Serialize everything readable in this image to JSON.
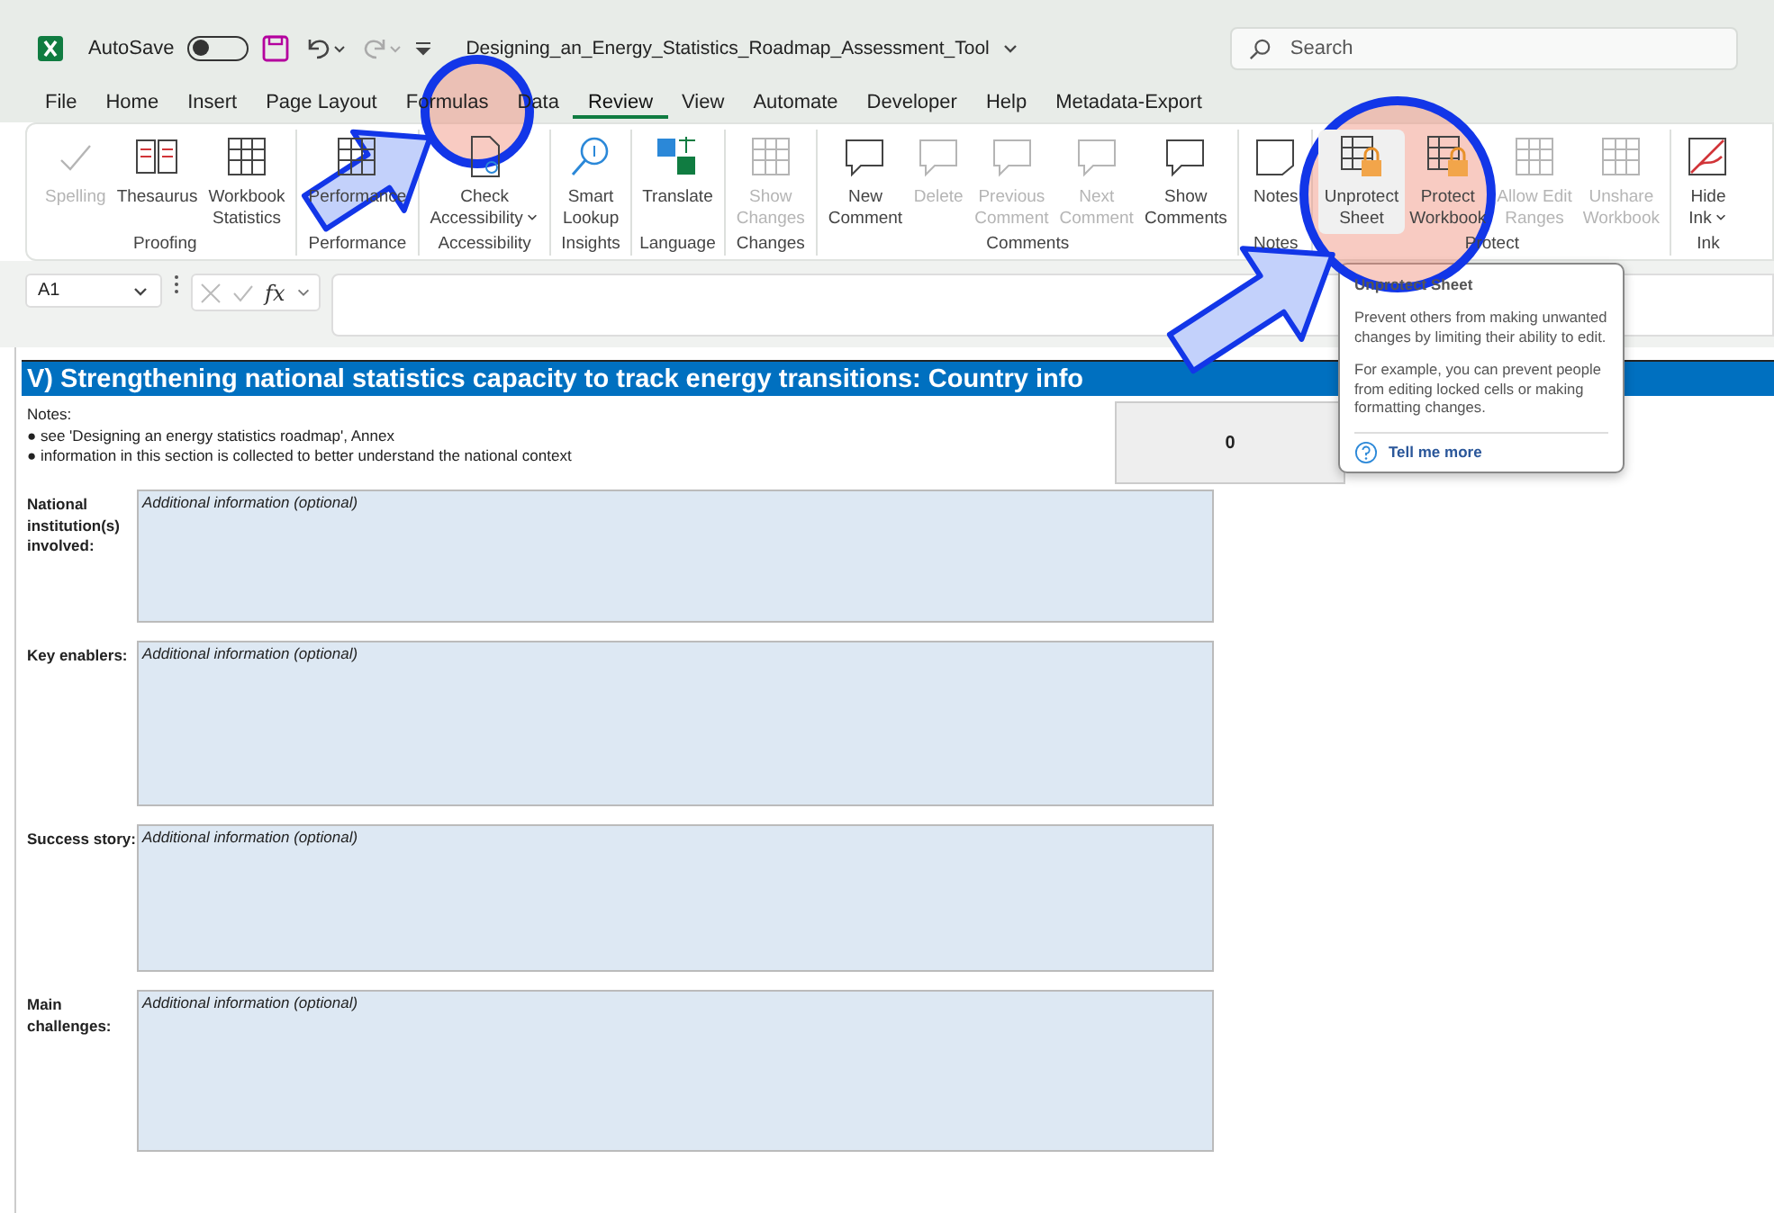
{
  "title_bar": {
    "autosave": {
      "label": "AutoSave",
      "on": false
    },
    "file_name": "Designing_an_Energy_Statistics_Roadmap_Assessment_Tool",
    "search": {
      "placeholder": "Search"
    }
  },
  "tabs": [
    {
      "label": "File",
      "selected": false
    },
    {
      "label": "Home",
      "selected": false
    },
    {
      "label": "Insert",
      "selected": false
    },
    {
      "label": "Page Layout",
      "selected": false
    },
    {
      "label": "Formulas",
      "selected": false
    },
    {
      "label": "Data",
      "selected": false
    },
    {
      "label": "Review",
      "selected": true
    },
    {
      "label": "View",
      "selected": false
    },
    {
      "label": "Automate",
      "selected": false
    },
    {
      "label": "Developer",
      "selected": false
    },
    {
      "label": "Help",
      "selected": false
    },
    {
      "label": "Metadata-Export",
      "selected": false
    }
  ],
  "ribbon_groups": [
    {
      "label": "Proofing",
      "buttons": [
        {
          "label": "Spelling",
          "disabled": true,
          "highlighted": false
        },
        {
          "label": "Thesaurus",
          "disabled": false,
          "highlighted": false
        },
        {
          "label": "Workbook\nStatistics",
          "disabled": false,
          "highlighted": false
        }
      ]
    },
    {
      "label": "Performance",
      "buttons": [
        {
          "label": "Performance",
          "disabled": false,
          "highlighted": false
        }
      ]
    },
    {
      "label": "Accessibility",
      "buttons": [
        {
          "label": "Check\nAccessibility",
          "disabled": false,
          "highlighted": false,
          "dropdown": true
        }
      ]
    },
    {
      "label": "Insights",
      "buttons": [
        {
          "label": "Smart\nLookup",
          "disabled": false,
          "highlighted": false
        }
      ]
    },
    {
      "label": "Language",
      "buttons": [
        {
          "label": "Translate",
          "disabled": false,
          "highlighted": false
        }
      ]
    },
    {
      "label": "Changes",
      "buttons": [
        {
          "label": "Show\nChanges",
          "disabled": true,
          "highlighted": false
        }
      ]
    },
    {
      "label": "Comments",
      "buttons": [
        {
          "label": "New\nComment",
          "disabled": false,
          "highlighted": false
        },
        {
          "label": "Delete",
          "disabled": true,
          "highlighted": false
        },
        {
          "label": "Previous\nComment",
          "disabled": true,
          "highlighted": false
        },
        {
          "label": "Next\nComment",
          "disabled": true,
          "highlighted": false
        },
        {
          "label": "Show\nComments",
          "disabled": false,
          "highlighted": false
        }
      ]
    },
    {
      "label": "Notes",
      "buttons": [
        {
          "label": "Notes",
          "disabled": false,
          "highlighted": false
        }
      ]
    },
    {
      "label": "Protect",
      "buttons": [
        {
          "label": "Unprotect\nSheet",
          "disabled": false,
          "highlighted": true
        },
        {
          "label": "Protect\nWorkbook",
          "disabled": false,
          "highlighted": false
        },
        {
          "label": "Allow Edit\nRanges",
          "disabled": true,
          "highlighted": false
        },
        {
          "label": "Unshare\nWorkbook",
          "disabled": true,
          "highlighted": false
        }
      ]
    },
    {
      "label": "Ink",
      "buttons": [
        {
          "label": "Hide\nInk",
          "disabled": false,
          "highlighted": false,
          "dropdown": true
        }
      ]
    }
  ],
  "formula_bar": {
    "name_box": "A1",
    "function_label": "fx"
  },
  "sheet": {
    "section_title": "V) Strengthening national statistics capacity to track energy transitions: Country info",
    "notes_heading": "Notes:",
    "notes": [
      "● see 'Designing an energy statistics roadmap', Annex",
      "● information in this section is collected to better understand the national context"
    ],
    "score": "0",
    "fields": [
      {
        "label": "National institution(s) involved:",
        "text": "Additional information (optional)"
      },
      {
        "label": "Key enablers:",
        "text": "Additional information (optional)"
      },
      {
        "label": "Success story:",
        "text": "Additional information (optional)"
      },
      {
        "label": "Main challenges:",
        "text": "Additional information (optional)"
      }
    ]
  },
  "tooltip": {
    "title": "Unprotect Sheet",
    "paragraphs": [
      "Prevent others from making unwanted changes by limiting their ability to edit.",
      "For example, you can prevent people from editing locked cells or making formatting changes."
    ],
    "link": "Tell me more"
  }
}
